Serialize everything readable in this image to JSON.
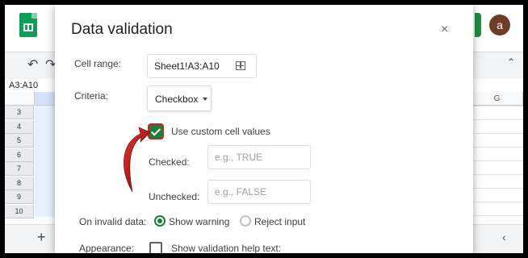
{
  "sheet": {
    "name_box": "A3:A10",
    "row_numbers": [
      "3",
      "4",
      "5",
      "6",
      "7",
      "8",
      "9",
      "10"
    ],
    "column_g": "G",
    "add_sheet": "+",
    "user_initial": "a"
  },
  "dialog": {
    "title": "Data validation",
    "close_icon": "×",
    "cell_range_label": "Cell range:",
    "cell_range_value": "Sheet1!A3:A10",
    "criteria_label": "Criteria:",
    "criteria_value": "Checkbox",
    "custom_values_label": "Use custom cell values",
    "custom_values_checked": true,
    "checked_label": "Checked:",
    "checked_placeholder": "e.g., TRUE",
    "unchecked_label": "Unchecked:",
    "unchecked_placeholder": "e.g., FALSE",
    "invalid_label": "On invalid data:",
    "invalid_options": [
      "Show warning",
      "Reject input"
    ],
    "invalid_selected": "Show warning",
    "appearance_label": "Appearance:",
    "appearance_option": "Show validation help text:"
  },
  "colors": {
    "accent": "#188038",
    "annotation_arrow": "#b71c1c"
  },
  "icons": [
    "sheets-logo-icon",
    "undo-icon",
    "redo-icon",
    "close-icon",
    "grid-select-icon",
    "dropdown-caret-icon",
    "check-icon",
    "annotation-arrow-icon",
    "chevron-left-icon",
    "chevron-up-icon"
  ]
}
